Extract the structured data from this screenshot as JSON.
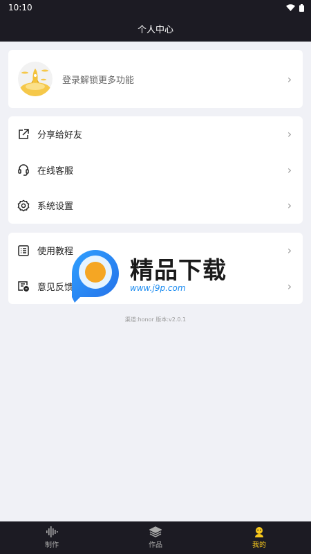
{
  "status": {
    "time": "10:10"
  },
  "header": {
    "title": "个人中心"
  },
  "login": {
    "label": "登录解锁更多功能"
  },
  "menu1": [
    {
      "label": "分享给好友",
      "icon": "share-icon"
    },
    {
      "label": "在线客服",
      "icon": "headset-icon"
    },
    {
      "label": "系统设置",
      "icon": "gear-icon"
    }
  ],
  "menu2": [
    {
      "label": "使用教程",
      "icon": "list-icon"
    },
    {
      "label": "意见反馈",
      "icon": "feedback-icon"
    }
  ],
  "version": "渠道:honor 版本:v2.0.1",
  "watermark": {
    "text": "精品下载",
    "url": "www.j9p.com"
  },
  "tabs": [
    {
      "label": "制作",
      "icon": "waveform-icon",
      "active": false
    },
    {
      "label": "作品",
      "icon": "layers-icon",
      "active": false
    },
    {
      "label": "我的",
      "icon": "profile-icon",
      "active": true
    }
  ],
  "colors": {
    "bar": "#1c1b23",
    "accent": "#f8c81c",
    "background": "#f0f1f6"
  }
}
